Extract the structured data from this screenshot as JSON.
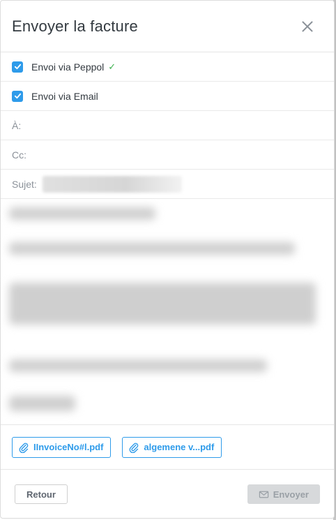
{
  "header": {
    "title": "Envoyer la facture"
  },
  "options": {
    "peppol_label": "Envoi via Peppol",
    "peppol_check_mark": "✓",
    "email_label": "Envoi via Email"
  },
  "fields": {
    "to_label": "À:",
    "cc_label": "Cc:",
    "subject_label": "Sujet:"
  },
  "attachments": [
    {
      "name": "IInvoiceNo#l.pdf"
    },
    {
      "name": "algemene v...pdf"
    }
  ],
  "footer": {
    "back_label": "Retour",
    "send_label": "Envoyer"
  },
  "colors": {
    "accent": "#2e9bea",
    "success": "#3db14f",
    "disabled_bg": "#d7d9db"
  }
}
